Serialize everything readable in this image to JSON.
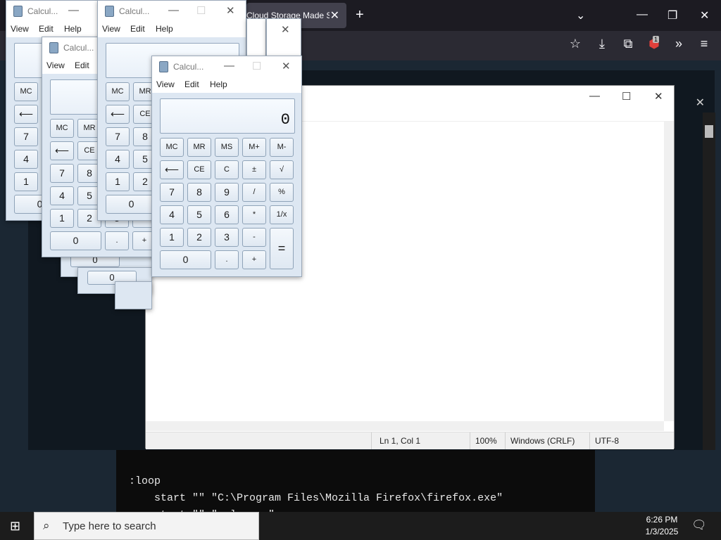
{
  "firefox": {
    "tab_title": "Cloud Storage Made Si",
    "new_tab": "+",
    "badge": "1"
  },
  "terminal": {
    "lines": [
      ":loop",
      "    start \"\" \"C:\\Program Files\\Mozilla Firefox\\firefox.exe\"",
      "    start \"\" \"calc.exe\""
    ]
  },
  "notepad": {
    "status": {
      "pos": "Ln 1, Col 1",
      "zoom": "100%",
      "eol": "Windows (CRLF)",
      "enc": "UTF-8"
    }
  },
  "calculator": {
    "title": "Calcul...",
    "menu": [
      "View",
      "Edit",
      "Help"
    ],
    "display": "0",
    "keys": {
      "mc": "MC",
      "mr": "MR",
      "ms": "MS",
      "mplus": "M+",
      "mminus": "M-",
      "back": "⟵",
      "ce": "CE",
      "c": "C",
      "pm": "±",
      "sqrt": "√",
      "n7": "7",
      "n8": "8",
      "n9": "9",
      "div": "/",
      "pct": "%",
      "n4": "4",
      "n5": "5",
      "n6": "6",
      "mul": "*",
      "inv": "1/x",
      "n1": "1",
      "n2": "2",
      "n3": "3",
      "sub": "-",
      "eq": "=",
      "n0": "0",
      "dot": ".",
      "add": "+"
    }
  },
  "taskbar": {
    "search_placeholder": "Type here to search",
    "time": "6:26 PM",
    "date": "1/3/2025"
  }
}
